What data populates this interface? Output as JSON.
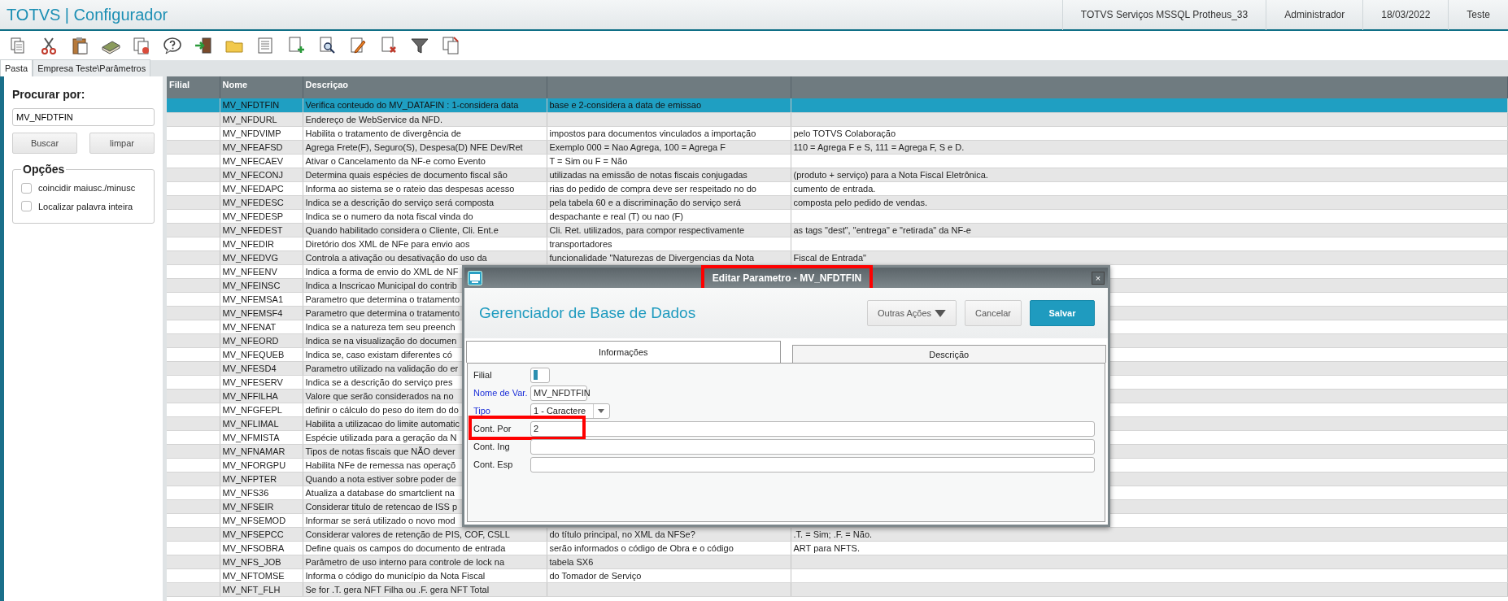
{
  "app": {
    "title": "TOTVS | Configurador",
    "info": [
      "TOTVS Serviços MSSQL Protheus_33",
      "Administrador",
      "18/03/2022",
      "Teste"
    ]
  },
  "tabs": [
    {
      "label": "Pasta",
      "selected": true
    },
    {
      "label": "Empresa Teste\\Parâmetros",
      "selected": false
    }
  ],
  "search_panel": {
    "label": "Procurar por:",
    "value": "MV_NFDTFIN",
    "buttons": [
      "Buscar",
      "limpar"
    ],
    "options_title": "Opções",
    "options": [
      {
        "label": "coincidir maiusc./minusc",
        "checked": false
      },
      {
        "label": "Localizar palavra inteira",
        "checked": false
      }
    ]
  },
  "table": {
    "columns": [
      "Filial",
      "Nome",
      "Descriçao"
    ],
    "rows": [
      {
        "name": "MV_NFDTFIN",
        "description": "Verifica conteudo do MV_DATAFIN : 1-considera data",
        "column_4": "base e 2-considera a data de emissao",
        "selected": true
      },
      {
        "name": "MV_NFDURL",
        "description": "Endereço de WebService da NFD.",
        "selected": false
      },
      {
        "name": "MV_NFDVIMP",
        "description": "Habilita o tratamento de divergência de",
        "column_4": "impostos para documentos vinculados a importação",
        "column_5": "pelo TOTVS Colaboração",
        "selected": false
      },
      {
        "name": "MV_NFEAFSD",
        "description": "Agrega Frete(F), Seguro(S), Despesa(D) NFE Dev/Ret",
        "column_4": "Exemplo 000 = Nao Agrega, 100 = Agrega F",
        "column_5": "110 = Agrega F e S, 111 = Agrega F, S e D.",
        "selected": false
      },
      {
        "name": "MV_NFECAEV",
        "description": "Ativar o Cancelamento da NF-e como Evento",
        "column_4": "T = Sim ou F = Não",
        "selected": false
      },
      {
        "name": "MV_NFECONJ",
        "description": "Determina quais espécies de documento fiscal são",
        "column_4": "utilizadas na emissão de notas fiscais conjugadas",
        "column_5": "(produto + serviço) para a Nota Fiscal Eletrônica.",
        "selected": false
      },
      {
        "name": "MV_NFEDAPC",
        "description": "Informa ao sistema se o rateio das despesas acesso",
        "column_4": "rias do pedido de compra deve ser respeitado no do",
        "column_5": "cumento de entrada.",
        "selected": false
      },
      {
        "name": "MV_NFEDESC",
        "description": "Indica se a descrição do serviço será composta",
        "column_4": "pela tabela 60 e a discriminação do serviço será",
        "column_5": "composta pelo pedido de vendas.",
        "selected": false
      },
      {
        "name": "MV_NFEDESP",
        "description": "Indica se o numero da nota fiscal vinda do",
        "column_4": "despachante e real (T) ou nao (F)",
        "selected": false
      },
      {
        "name": "MV_NFEDEST",
        "description": "Quando habilitado considera o Cliente, Cli. Ent.e",
        "column_4": "Cli. Ret. utilizados, para compor respectivamente",
        "column_5": "as tags \"dest\", \"entrega\" e \"retirada\" da NF-e",
        "selected": false
      },
      {
        "name": "MV_NFEDIR",
        "description": "Diretório dos XML de NFe para envio aos",
        "column_4": "transportadores",
        "selected": false
      },
      {
        "name": "MV_NFEDVG",
        "description": "Controla a ativação ou desativação do uso da",
        "column_4": "funcionalidade \"Naturezas de Divergencias da Nota",
        "column_5": "Fiscal de Entrada\"",
        "selected": false
      },
      {
        "name": "MV_NFEENV",
        "description": "Indica a forma de envio do XML de NF",
        "selected": false
      },
      {
        "name": "MV_NFEINSC",
        "description": "Indica a Inscricao Municipal do contrib",
        "selected": false
      },
      {
        "name": "MV_NFEMSA1",
        "description": "Parametro que determina o tratamento",
        "selected": false
      },
      {
        "name": "MV_NFEMSF4",
        "description": "Parametro que determina o tratamento",
        "selected": false
      },
      {
        "name": "MV_NFENAT",
        "description": "Indica se a natureza tem seu preench",
        "selected": false
      },
      {
        "name": "MV_NFEORD",
        "description": "Indica se na visualização do documen",
        "selected": false
      },
      {
        "name": "MV_NFEQUEB",
        "description": "Indica se, caso existam diferentes có",
        "selected": false
      },
      {
        "name": "MV_NFESD4",
        "description": "Parametro utilizado na validação do er",
        "selected": false
      },
      {
        "name": "MV_NFESERV",
        "description": "Indica se a descrição do serviço pres",
        "selected": false
      },
      {
        "name": "MV_NFFILHA",
        "description": "Valore que serão considerados na no",
        "selected": false
      },
      {
        "name": "MV_NFGFEPL",
        "description": "definir o cálculo do peso do item do do",
        "selected": false
      },
      {
        "name": "MV_NFLIMAL",
        "description": "Habilita a utilizacao do limite automatic",
        "selected": false
      },
      {
        "name": "MV_NFMISTA",
        "description": "Espécie utilizada para a geração da N",
        "selected": false
      },
      {
        "name": "MV_NFNAMAR",
        "description": "Tipos de notas fiscais que NÃO dever",
        "selected": false
      },
      {
        "name": "MV_NFORGPU",
        "description": "Habilita NFe de remessa nas operaçõ",
        "selected": false
      },
      {
        "name": "MV_NFPTER",
        "description": "Quando a nota estiver sobre poder de",
        "selected": false
      },
      {
        "name": "MV_NFS36",
        "description": "Atualiza a database do smartclient na",
        "selected": false
      },
      {
        "name": "MV_NFSEIR",
        "description": "Considerar titulo de retencao de ISS p",
        "selected": false
      },
      {
        "name": "MV_NFSEMOD",
        "description": "Informar se será utilizado o novo mod",
        "selected": false
      },
      {
        "name": "MV_NFSEPCC",
        "description": "Considerar valores de retenção de PIS, COF, CSLL",
        "column_4": "do título principal, no XML da NFSe?",
        "column_5": ".T. = Sim; .F. = Não.",
        "selected": false
      },
      {
        "name": "MV_NFSOBRA",
        "description": "Define quais os campos do documento de entrada",
        "column_4": "serão informados o código de Obra e o código",
        "column_5": "ART para NFTS.",
        "selected": false
      },
      {
        "name": "MV_NFS_JOB",
        "description": "Parâmetro de uso interno para controle de lock na",
        "column_4": "tabela SX6",
        "selected": false
      },
      {
        "name": "MV_NFTOMSE",
        "description": "Informa o código do município da Nota Fiscal",
        "column_4": "do Tomador de Serviço",
        "selected": false
      },
      {
        "name": "MV_NFT_FLH",
        "description": "Se for .T. gera NFT Filha ou .F. gera NFT Total",
        "selected": false
      }
    ]
  },
  "dialog": {
    "title": "Editar Parametro - MV_NFDTFIN",
    "title_highlighted": true,
    "close": "×",
    "heading": "Gerenciador de Base de Dados",
    "buttons": [
      {
        "label": "Outras Ações",
        "kind": "menu"
      },
      {
        "label": "Cancelar",
        "kind": "default"
      },
      {
        "label": "Salvar",
        "kind": "primary"
      }
    ],
    "tabs": [
      {
        "label": "Informações",
        "selected": true
      },
      {
        "label": "Descrição",
        "selected": false
      }
    ],
    "fields": [
      {
        "label": "Filial",
        "kind": "small",
        "required": false,
        "highlighted": false
      },
      {
        "label": "Nome de Var.",
        "kind": "short",
        "value": "MV_NFDTFIN",
        "required": true,
        "highlighted": false
      },
      {
        "label": "Tipo",
        "kind": "select",
        "value": "1 - Caractere",
        "required": true,
        "highlighted": false
      },
      {
        "label": "Cont. Por",
        "kind": "text",
        "value": "2",
        "required": false,
        "highlighted": true
      },
      {
        "label": "Cont. Ing",
        "kind": "text",
        "required": false,
        "highlighted": false
      },
      {
        "label": "Cont. Esp",
        "kind": "text",
        "required": false,
        "highlighted": false
      }
    ]
  }
}
